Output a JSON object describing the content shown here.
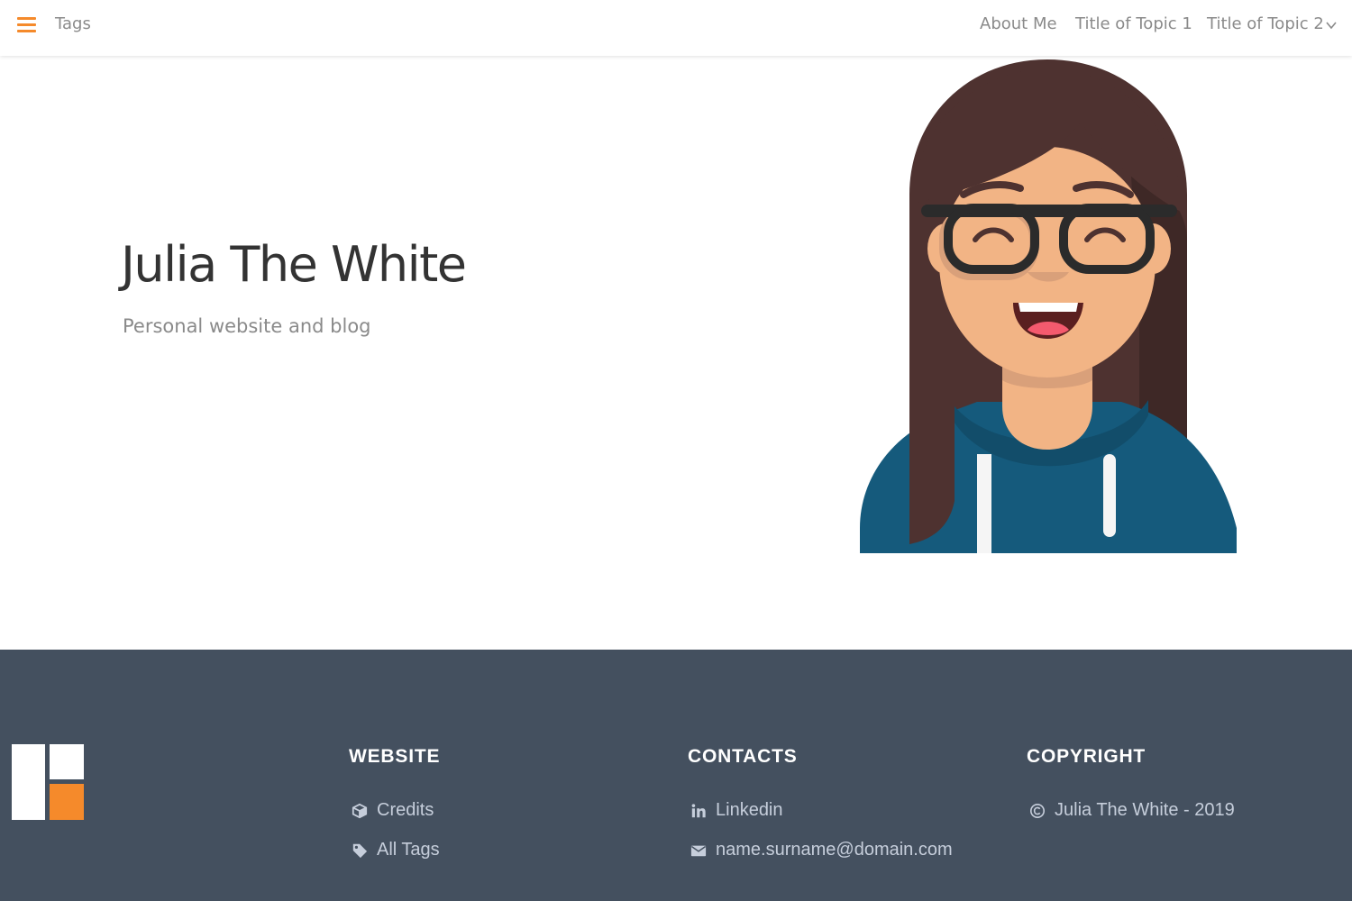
{
  "navbar": {
    "menu_icon": "hamburger-menu-icon",
    "tags_label": "Tags",
    "links": [
      {
        "label": "About Me"
      },
      {
        "label": "Title of Topic 1"
      },
      {
        "label": "Title of Topic 2",
        "icon": "chevron-down-icon"
      }
    ]
  },
  "hero": {
    "title": "Julia The White",
    "subtitle": "Personal website and blog",
    "avatar_icon": "avatar-illustration"
  },
  "footer": {
    "logo_icon": "site-logo-icon",
    "website": {
      "heading": "WEBSITE",
      "items": [
        {
          "label": "Credits",
          "icon": "cube-icon"
        },
        {
          "label": "All Tags",
          "icon": "tag-icon"
        }
      ]
    },
    "contacts": {
      "heading": "CONTACTS",
      "items": [
        {
          "label": "Linkedin",
          "icon": "linkedin-icon"
        },
        {
          "label": "name.surname@domain.com",
          "icon": "envelope-icon"
        }
      ]
    },
    "copyright": {
      "heading": "COPYRIGHT",
      "items": [
        {
          "label": "Julia The White - 2019",
          "icon": "copyright-icon"
        }
      ]
    }
  },
  "colors": {
    "accent": "#f58a2b",
    "nav_text": "#8a8a8a",
    "title_text": "#333333",
    "footer_bg": "#44505f",
    "footer_link": "#c6cedb",
    "hoodie": "#155a7c",
    "hair": "#4e3230",
    "skin": "#f2b485"
  }
}
